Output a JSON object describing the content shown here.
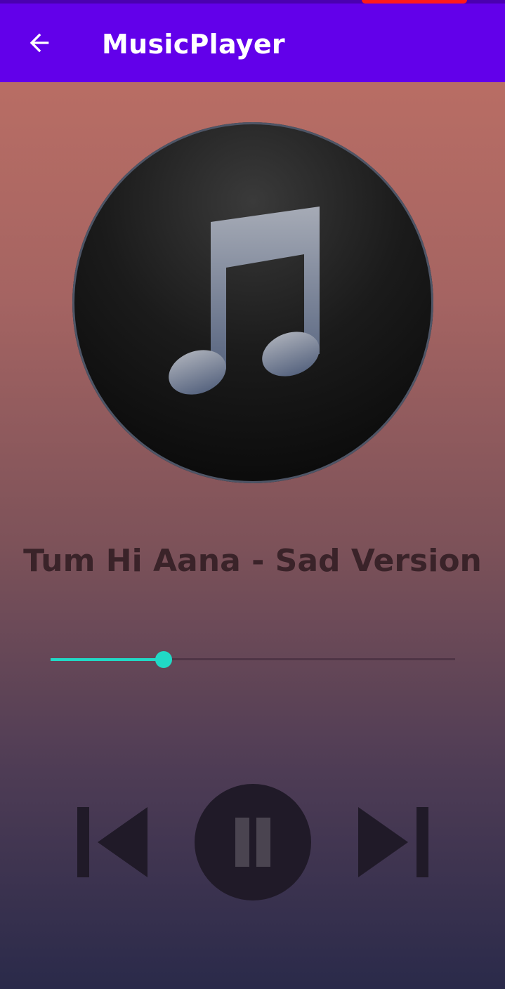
{
  "app_bar": {
    "title": "MusicPlayer",
    "back_icon": "arrow-left-icon",
    "color": "#6200ea"
  },
  "album_art": {
    "icon": "music-note-icon"
  },
  "now_playing": {
    "title": "Tum Hi Aana - Sad Version"
  },
  "seek": {
    "progress": 0.28,
    "accent_color": "#21d9c6"
  },
  "controls": {
    "previous_icon": "skip-previous-icon",
    "pause_icon": "pause-icon",
    "next_icon": "skip-next-icon"
  }
}
